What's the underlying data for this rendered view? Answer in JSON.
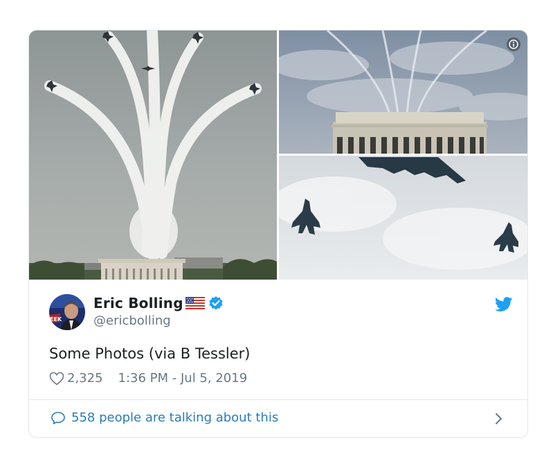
{
  "tweet": {
    "author_name": "Eric Bolling",
    "author_handle": "@ericbolling",
    "text": "Some Photos (via B Tessler)",
    "likes": "2,325",
    "timestamp": "1:36 PM - Jul 5, 2019",
    "conversation_text": "558 people are talking about this",
    "avatar_badge_text": "EEK"
  },
  "icons": {
    "info": "info-icon",
    "verified": "verified-badge-icon",
    "flag": "us-flag-emoji",
    "twitter": "twitter-bird-icon",
    "like": "heart-icon",
    "reply": "speech-bubble-icon",
    "more": "chevron-right-icon"
  },
  "colors": {
    "link": "#2b7bb9",
    "twitter_blue": "#1da1f2",
    "secondary_text": "#697882",
    "border": "#e1e8ed"
  }
}
